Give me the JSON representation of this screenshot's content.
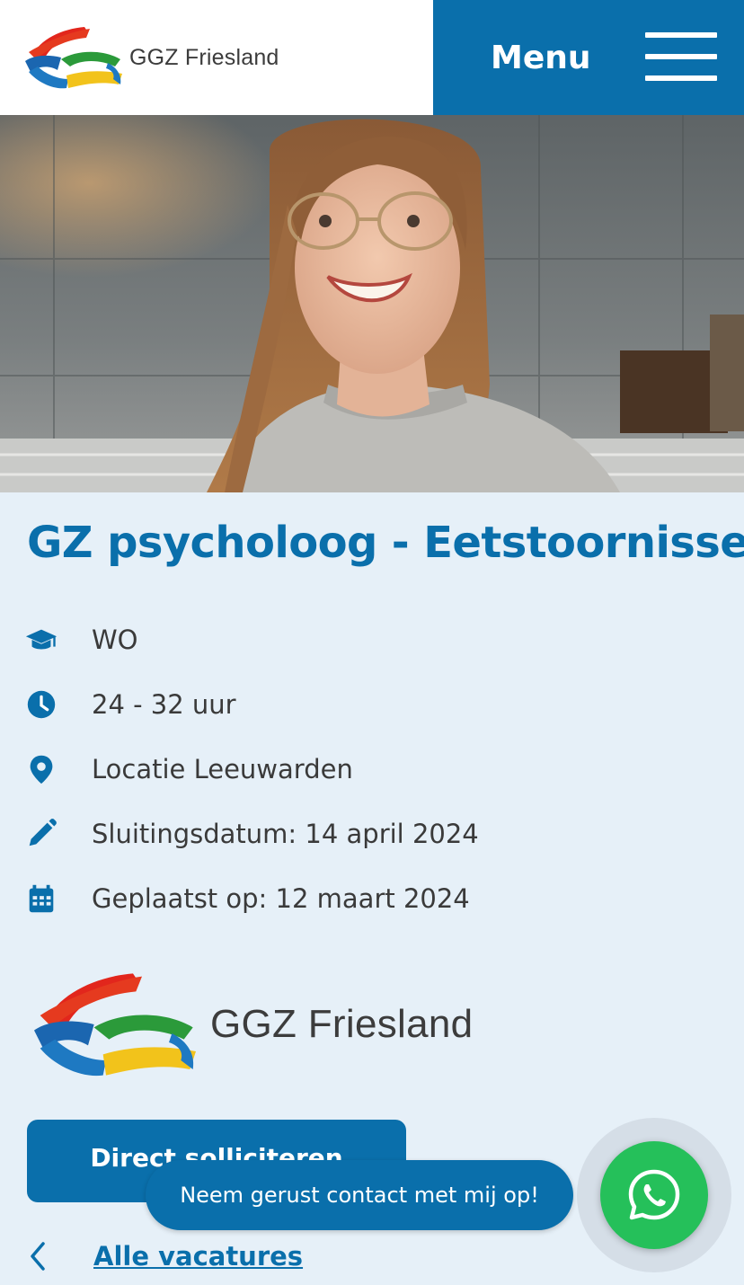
{
  "header": {
    "logo_text": "GGZ Friesland",
    "menu_label": "Menu"
  },
  "job": {
    "title": "GZ psycholoog - Eetstoornissen",
    "details": [
      {
        "icon": "graduation-cap-icon",
        "text": "WO"
      },
      {
        "icon": "clock-icon",
        "text": "24 - 32 uur"
      },
      {
        "icon": "location-pin-icon",
        "text": "Locatie Leeuwarden"
      },
      {
        "icon": "pencil-icon",
        "text": "Sluitingsdatum: 14 april 2024"
      },
      {
        "icon": "calendar-icon",
        "text": "Geplaatst op: 12 maart 2024"
      }
    ],
    "company_logo_text": "GGZ Friesland"
  },
  "actions": {
    "apply_label": "Direct solliciteren",
    "contact_bubble": "Neem gerust contact met mij op!",
    "back_label": "Alle vacatures"
  },
  "colors": {
    "brand_blue": "#0a6fab",
    "background": "#e6f0f8",
    "whatsapp_green": "#25c05a"
  }
}
